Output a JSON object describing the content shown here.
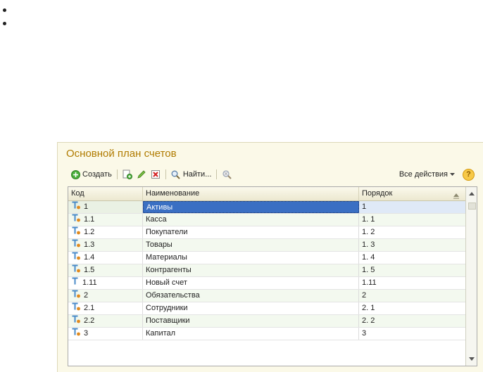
{
  "form": {
    "title": "Основной план счетов"
  },
  "toolbar": {
    "create_label": "Создать",
    "find_label": "Найти...",
    "all_actions_label": "Все действия",
    "help_label": "?"
  },
  "grid": {
    "columns": [
      "Код",
      "Наименование",
      "Порядок"
    ],
    "rows": [
      {
        "code": "1",
        "name": "Активы",
        "order": "1",
        "selected": true
      },
      {
        "code": "1.1",
        "name": "Касса",
        "order": "1. 1"
      },
      {
        "code": "1.2",
        "name": "Покупатели",
        "order": "1. 2"
      },
      {
        "code": "1.3",
        "name": "Товары",
        "order": "1. 3"
      },
      {
        "code": "1.4",
        "name": "Материалы",
        "order": "1. 4"
      },
      {
        "code": "1.5",
        "name": "Контрагенты",
        "order": "1. 5"
      },
      {
        "code": "1.11",
        "name": "Новый счет",
        "order": "1.11"
      },
      {
        "code": "2",
        "name": "Обязательства",
        "order": "2"
      },
      {
        "code": "2.1",
        "name": "Сотрудники",
        "order": "2. 1"
      },
      {
        "code": "2.2",
        "name": "Поставщики",
        "order": "2. 2"
      },
      {
        "code": "3",
        "name": "Капитал",
        "order": "3"
      }
    ]
  },
  "colors": {
    "title": "#b07b00",
    "selection": "#3a6fc3",
    "form_background": "#fbf9e8"
  }
}
